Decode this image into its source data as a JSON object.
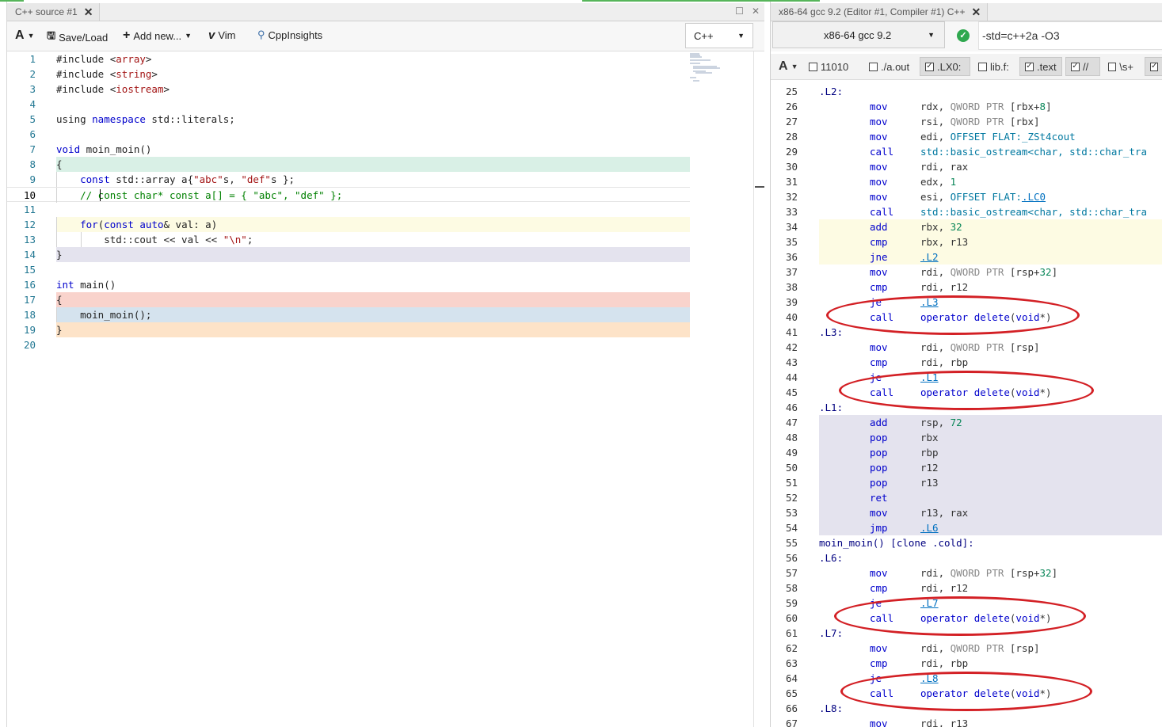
{
  "left_pane": {
    "tab_title": "C++ source #1",
    "toolbar": {
      "font_label": "A",
      "save_load": "Save/Load",
      "add_new": "Add new...",
      "vim": "Vim",
      "cppinsights": "CppInsights",
      "language": "C++"
    },
    "code_lines": [
      {
        "n": "1",
        "text": "#include <array>",
        "hl": ""
      },
      {
        "n": "2",
        "text": "#include <string>",
        "hl": ""
      },
      {
        "n": "3",
        "text": "#include <iostream>",
        "hl": ""
      },
      {
        "n": "4",
        "text": "",
        "hl": ""
      },
      {
        "n": "5",
        "text": "using namespace std::literals;",
        "hl": ""
      },
      {
        "n": "6",
        "text": "",
        "hl": ""
      },
      {
        "n": "7",
        "text": "void moin_moin()",
        "hl": ""
      },
      {
        "n": "8",
        "text": "{",
        "hl": "#d9f0e6"
      },
      {
        "n": "9",
        "text": "    const std::array a{\"abc\"s, \"def\"s };",
        "hl": ""
      },
      {
        "n": "10",
        "text": "    // const char* const a[] = { \"abc\", \"def\" };",
        "hl": ""
      },
      {
        "n": "11",
        "text": "",
        "hl": ""
      },
      {
        "n": "12",
        "text": "    for(const auto& val: a)",
        "hl": "#fdfbe3"
      },
      {
        "n": "13",
        "text": "        std::cout << val << \"\\n\";",
        "hl": ""
      },
      {
        "n": "14",
        "text": "}",
        "hl": "#e4e3ee"
      },
      {
        "n": "15",
        "text": "",
        "hl": ""
      },
      {
        "n": "16",
        "text": "int main()",
        "hl": ""
      },
      {
        "n": "17",
        "text": "{",
        "hl": "#f9d3cc"
      },
      {
        "n": "18",
        "text": "    moin_moin();",
        "hl": "#d5e3ee"
      },
      {
        "n": "19",
        "text": "}",
        "hl": "#fde3c8"
      },
      {
        "n": "20",
        "text": "",
        "hl": ""
      }
    ]
  },
  "right_pane": {
    "tab_title": "x86-64 gcc 9.2 (Editor #1, Compiler #1) C++",
    "compiler": "x86-64 gcc 9.2",
    "flags": "-std=c++2a -O3",
    "filters": [
      {
        "label": "11010",
        "checked": false,
        "on": false
      },
      {
        "label": "./a.out",
        "checked": false,
        "on": false
      },
      {
        "label": ".LX0:",
        "checked": true,
        "on": true
      },
      {
        "label": "lib.f:",
        "checked": false,
        "on": false
      },
      {
        "label": ".text",
        "checked": true,
        "on": true
      },
      {
        "label": "//",
        "checked": true,
        "on": true
      },
      {
        "label": "\\s+",
        "checked": false,
        "on": false
      }
    ],
    "asm_lines": [
      {
        "n": "25",
        "label": ".L2:",
        "op": "",
        "args": "",
        "hl": ""
      },
      {
        "n": "26",
        "label": "",
        "op": "mov",
        "args": "rdx, QWORD PTR [rbx+8]",
        "hl": ""
      },
      {
        "n": "27",
        "label": "",
        "op": "mov",
        "args": "rsi, QWORD PTR [rbx]",
        "hl": ""
      },
      {
        "n": "28",
        "label": "",
        "op": "mov",
        "args": "edi, OFFSET FLAT:_ZSt4cout",
        "hl": ""
      },
      {
        "n": "29",
        "label": "",
        "op": "call",
        "args": "std::basic_ostream<char, std::char_tra",
        "hl": ""
      },
      {
        "n": "30",
        "label": "",
        "op": "mov",
        "args": "rdi, rax",
        "hl": ""
      },
      {
        "n": "31",
        "label": "",
        "op": "mov",
        "args": "edx, 1",
        "hl": ""
      },
      {
        "n": "32",
        "label": "",
        "op": "mov",
        "args": "esi, OFFSET FLAT:.LC0",
        "hl": ""
      },
      {
        "n": "33",
        "label": "",
        "op": "call",
        "args": "std::basic_ostream<char, std::char_tra",
        "hl": ""
      },
      {
        "n": "34",
        "label": "",
        "op": "add",
        "args": "rbx, 32",
        "hl": "#fdfbe3"
      },
      {
        "n": "35",
        "label": "",
        "op": "cmp",
        "args": "rbx, r13",
        "hl": "#fdfbe3"
      },
      {
        "n": "36",
        "label": "",
        "op": "jne",
        "args": ".L2",
        "hl": "#fdfbe3"
      },
      {
        "n": "37",
        "label": "",
        "op": "mov",
        "args": "rdi, QWORD PTR [rsp+32]",
        "hl": ""
      },
      {
        "n": "38",
        "label": "",
        "op": "cmp",
        "args": "rdi, r12",
        "hl": ""
      },
      {
        "n": "39",
        "label": "",
        "op": "je",
        "args": ".L3",
        "hl": ""
      },
      {
        "n": "40",
        "label": "",
        "op": "call",
        "args": "operator delete(void*)",
        "hl": ""
      },
      {
        "n": "41",
        "label": ".L3:",
        "op": "",
        "args": "",
        "hl": ""
      },
      {
        "n": "42",
        "label": "",
        "op": "mov",
        "args": "rdi, QWORD PTR [rsp]",
        "hl": ""
      },
      {
        "n": "43",
        "label": "",
        "op": "cmp",
        "args": "rdi, rbp",
        "hl": ""
      },
      {
        "n": "44",
        "label": "",
        "op": "je",
        "args": ".L1",
        "hl": ""
      },
      {
        "n": "45",
        "label": "",
        "op": "call",
        "args": "operator delete(void*)",
        "hl": ""
      },
      {
        "n": "46",
        "label": ".L1:",
        "op": "",
        "args": "",
        "hl": ""
      },
      {
        "n": "47",
        "label": "",
        "op": "add",
        "args": "rsp, 72",
        "hl": "#e4e3ee"
      },
      {
        "n": "48",
        "label": "",
        "op": "pop",
        "args": "rbx",
        "hl": "#e4e3ee"
      },
      {
        "n": "49",
        "label": "",
        "op": "pop",
        "args": "rbp",
        "hl": "#e4e3ee"
      },
      {
        "n": "50",
        "label": "",
        "op": "pop",
        "args": "r12",
        "hl": "#e4e3ee"
      },
      {
        "n": "51",
        "label": "",
        "op": "pop",
        "args": "r13",
        "hl": "#e4e3ee"
      },
      {
        "n": "52",
        "label": "",
        "op": "ret",
        "args": "",
        "hl": "#e4e3ee"
      },
      {
        "n": "53",
        "label": "",
        "op": "mov",
        "args": "r13, rax",
        "hl": "#e4e3ee"
      },
      {
        "n": "54",
        "label": "",
        "op": "jmp",
        "args": ".L6",
        "hl": "#e4e3ee"
      },
      {
        "n": "55",
        "label": "moin_moin() [clone .cold]:",
        "op": "",
        "args": "",
        "hl": ""
      },
      {
        "n": "56",
        "label": ".L6:",
        "op": "",
        "args": "",
        "hl": ""
      },
      {
        "n": "57",
        "label": "",
        "op": "mov",
        "args": "rdi, QWORD PTR [rsp+32]",
        "hl": ""
      },
      {
        "n": "58",
        "label": "",
        "op": "cmp",
        "args": "rdi, r12",
        "hl": ""
      },
      {
        "n": "59",
        "label": "",
        "op": "je",
        "args": ".L7",
        "hl": ""
      },
      {
        "n": "60",
        "label": "",
        "op": "call",
        "args": "operator delete(void*)",
        "hl": ""
      },
      {
        "n": "61",
        "label": ".L7:",
        "op": "",
        "args": "",
        "hl": ""
      },
      {
        "n": "62",
        "label": "",
        "op": "mov",
        "args": "rdi, QWORD PTR [rsp]",
        "hl": ""
      },
      {
        "n": "63",
        "label": "",
        "op": "cmp",
        "args": "rdi, rbp",
        "hl": ""
      },
      {
        "n": "64",
        "label": "",
        "op": "je",
        "args": ".L8",
        "hl": ""
      },
      {
        "n": "65",
        "label": "",
        "op": "call",
        "args": "operator delete(void*)",
        "hl": ""
      },
      {
        "n": "66",
        "label": ".L8:",
        "op": "",
        "args": "",
        "hl": ""
      },
      {
        "n": "67",
        "label": "",
        "op": "mov",
        "args": "rdi, r13",
        "hl": ""
      }
    ]
  },
  "annotation_color": "#d32025",
  "annotated_lines": [
    "40",
    "45",
    "60",
    "65"
  ]
}
